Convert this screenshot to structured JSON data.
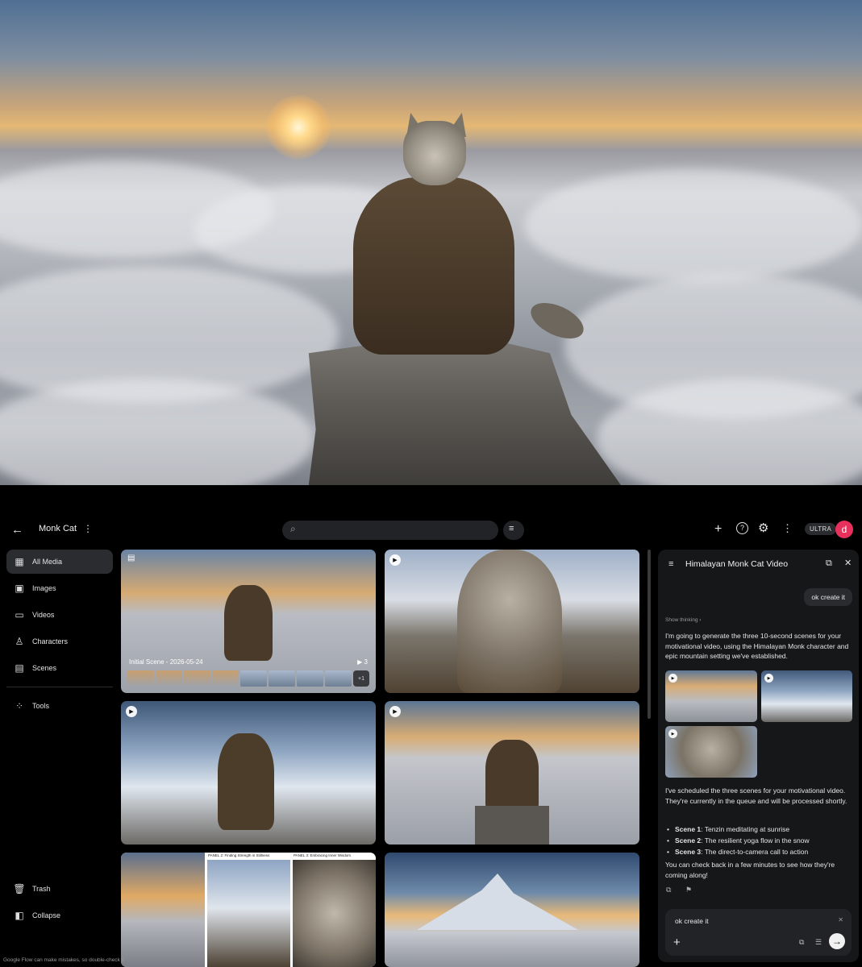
{
  "app": {
    "project_title": "Monk Cat",
    "search": {
      "placeholder": ""
    },
    "plan_badge": "ULTRA",
    "avatar_letter": "d"
  },
  "sidebar": {
    "items": [
      {
        "label": "All Media",
        "icon": "grid-icon",
        "active": true
      },
      {
        "label": "Images",
        "icon": "image-icon"
      },
      {
        "label": "Videos",
        "icon": "video-icon"
      },
      {
        "label": "Characters",
        "icon": "person-icon"
      },
      {
        "label": "Scenes",
        "icon": "clapperboard-icon"
      },
      {
        "label": "Tools",
        "icon": "dots-grid-icon"
      }
    ],
    "trash_label": "Trash",
    "collapse_label": "Collapse",
    "disclaimer": "Google Flow can make mistakes, so double-check it"
  },
  "grid": {
    "scene_tile": {
      "label": "Initial Scene - 2026-05-24",
      "count": "3",
      "more_badge": "+1"
    },
    "comic_panels": [
      "PANEL 2: Finding Strength in Stillness",
      "PANEL 3: Embracing Inner Wisdom"
    ]
  },
  "chat": {
    "title": "Himalayan Monk Cat Video",
    "user_message": "ok create it",
    "show_thinking": "Show thinking",
    "intro": "I'm going to generate the three 10-second scenes for your motivational video, using the Himalayan Monk character and epic mountain setting we've established.",
    "scheduled": "I've scheduled the three scenes for your motivational video. They're currently in the queue and will be processed shortly.",
    "scenes": [
      {
        "name": "Scene 1",
        "desc": ": Tenzin meditating at sunrise"
      },
      {
        "name": "Scene 2",
        "desc": ": The resilient yoga flow in the snow"
      },
      {
        "name": "Scene 3",
        "desc": ": The direct-to-camera call to action"
      }
    ],
    "followup": "You can check back in a few minutes to see how they're coming along!",
    "input_value": "ok create it"
  }
}
